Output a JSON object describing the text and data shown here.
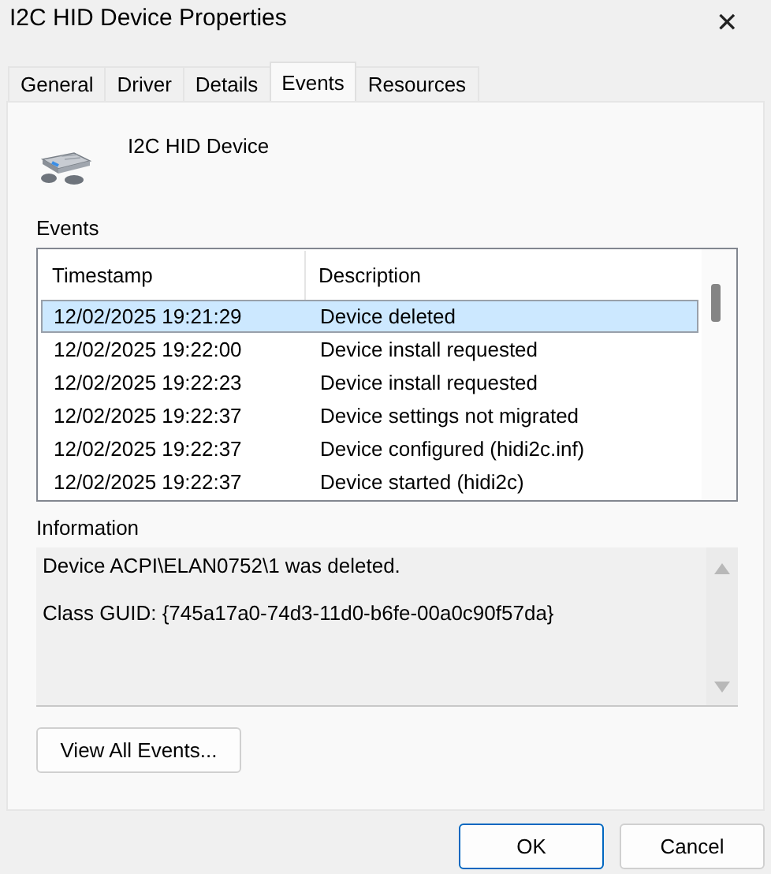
{
  "window": {
    "title": "I2C HID Device Properties",
    "close": "✕"
  },
  "tabs": [
    {
      "label": "General",
      "selected": false
    },
    {
      "label": "Driver",
      "selected": false
    },
    {
      "label": "Details",
      "selected": false
    },
    {
      "label": "Events",
      "selected": true
    },
    {
      "label": "Resources",
      "selected": false
    }
  ],
  "device": {
    "name": "I2C HID Device"
  },
  "events": {
    "label": "Events",
    "columns": [
      "Timestamp",
      "Description"
    ],
    "rows": [
      {
        "timestamp": "12/02/2025 19:21:29",
        "description": "Device deleted",
        "selected": true
      },
      {
        "timestamp": "12/02/2025 19:22:00",
        "description": "Device install requested",
        "selected": false
      },
      {
        "timestamp": "12/02/2025 19:22:23",
        "description": "Device install requested",
        "selected": false
      },
      {
        "timestamp": "12/02/2025 19:22:37",
        "description": "Device settings not migrated",
        "selected": false
      },
      {
        "timestamp": "12/02/2025 19:22:37",
        "description": "Device configured (hidi2c.inf)",
        "selected": false
      },
      {
        "timestamp": "12/02/2025 19:22:37",
        "description": "Device started (hidi2c)",
        "selected": false
      }
    ]
  },
  "information": {
    "label": "Information",
    "lines": [
      "Device ACPI\\ELAN0752\\1 was deleted.",
      "Class GUID: {745a17a0-74d3-11d0-b6fe-00a0c90f57da}"
    ]
  },
  "view_all_button": "View All Events...",
  "buttons": [
    "OK",
    "Cancel"
  ]
}
